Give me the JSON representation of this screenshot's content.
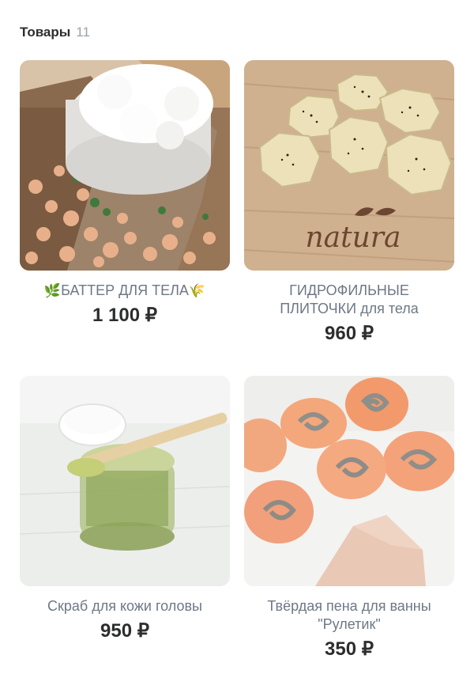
{
  "header": {
    "title": "Товары",
    "count": "11"
  },
  "products": [
    {
      "name": "БАТТЕР ДЛЯ ТЕЛА",
      "name_prefix_icon": "leaf-emoji",
      "name_suffix_icon": "wheat-emoji",
      "price": "1 100 ₽"
    },
    {
      "name": "ГИДРОФИЛЬНЫЕ ПЛИТОЧКИ для тела",
      "price": "960 ₽",
      "image_text": "natura"
    },
    {
      "name": "Скраб для кожи головы",
      "price": "950 ₽"
    },
    {
      "name": "Твёрдая пена для ванны \"Рулетик\"",
      "price": "350 ₽"
    }
  ]
}
